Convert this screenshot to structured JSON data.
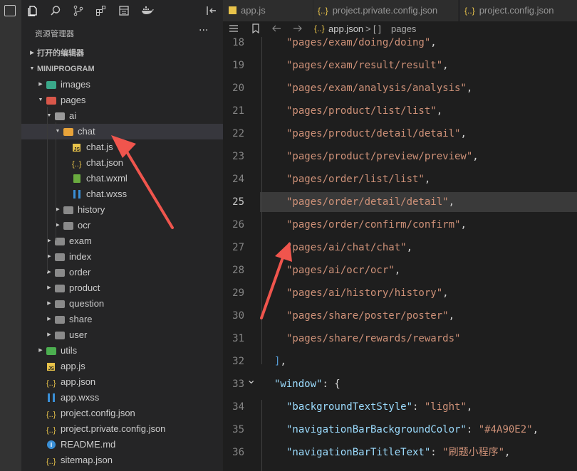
{
  "sidebar": {
    "title": "资源管理器",
    "more": "···",
    "tree": [
      {
        "label": "打开的编辑器",
        "kind": "section",
        "depth": 0,
        "chev": "right"
      },
      {
        "label": "MINIPROGRAM",
        "kind": "section",
        "depth": 0,
        "chev": "down"
      },
      {
        "label": "images",
        "kind": "folder-images",
        "depth": 1,
        "chev": "right"
      },
      {
        "label": "pages",
        "kind": "folder-pages",
        "depth": 1,
        "chev": "down"
      },
      {
        "label": "ai",
        "kind": "folder-open",
        "depth": 2,
        "chev": "down"
      },
      {
        "label": "chat",
        "kind": "folder-chat",
        "depth": 3,
        "chev": "down",
        "selected": true
      },
      {
        "label": "chat.js",
        "kind": "js",
        "depth": 4
      },
      {
        "label": "chat.json",
        "kind": "json",
        "depth": 4
      },
      {
        "label": "chat.wxml",
        "kind": "wxml",
        "depth": 4
      },
      {
        "label": "chat.wxss",
        "kind": "wxss",
        "depth": 4
      },
      {
        "label": "history",
        "kind": "folder",
        "depth": 3,
        "chev": "right"
      },
      {
        "label": "ocr",
        "kind": "folder",
        "depth": 3,
        "chev": "right"
      },
      {
        "label": "exam",
        "kind": "folder",
        "depth": 2,
        "chev": "right"
      },
      {
        "label": "index",
        "kind": "folder",
        "depth": 2,
        "chev": "right"
      },
      {
        "label": "order",
        "kind": "folder",
        "depth": 2,
        "chev": "right"
      },
      {
        "label": "product",
        "kind": "folder",
        "depth": 2,
        "chev": "right"
      },
      {
        "label": "question",
        "kind": "folder",
        "depth": 2,
        "chev": "right"
      },
      {
        "label": "share",
        "kind": "folder",
        "depth": 2,
        "chev": "right"
      },
      {
        "label": "user",
        "kind": "folder",
        "depth": 2,
        "chev": "right"
      },
      {
        "label": "utils",
        "kind": "folder-utils",
        "depth": 1,
        "chev": "right"
      },
      {
        "label": "app.js",
        "kind": "js",
        "depth": 1
      },
      {
        "label": "app.json",
        "kind": "json",
        "depth": 1
      },
      {
        "label": "app.wxss",
        "kind": "wxss",
        "depth": 1
      },
      {
        "label": "project.config.json",
        "kind": "json",
        "depth": 1
      },
      {
        "label": "project.private.config.json",
        "kind": "json",
        "depth": 1
      },
      {
        "label": "README.md",
        "kind": "info",
        "depth": 1
      },
      {
        "label": "sitemap.json",
        "kind": "json",
        "depth": 1
      }
    ]
  },
  "tabs": [
    {
      "label": "app.js",
      "icon": "JS"
    },
    {
      "label": "project.private.config.json",
      "icon": "{..}"
    },
    {
      "label": "project.config.json",
      "icon": "{..}"
    }
  ],
  "breadcrumb": {
    "icon": "{..}",
    "file": "app.json",
    "sep": ">",
    "node_icon": "[ ]",
    "node": "pages"
  },
  "editor": {
    "current_line": 25,
    "lines": [
      {
        "n": 18,
        "indent": 1,
        "str": "\"pages/exam/doing/doing\"",
        "tail": ","
      },
      {
        "n": 19,
        "indent": 1,
        "str": "\"pages/exam/result/result\"",
        "tail": ","
      },
      {
        "n": 20,
        "indent": 1,
        "str": "\"pages/exam/analysis/analysis\"",
        "tail": ","
      },
      {
        "n": 21,
        "indent": 1,
        "str": "\"pages/product/list/list\"",
        "tail": ","
      },
      {
        "n": 22,
        "indent": 1,
        "str": "\"pages/product/detail/detail\"",
        "tail": ","
      },
      {
        "n": 23,
        "indent": 1,
        "str": "\"pages/product/preview/preview\"",
        "tail": ","
      },
      {
        "n": 24,
        "indent": 1,
        "str": "\"pages/order/list/list\"",
        "tail": ","
      },
      {
        "n": 25,
        "indent": 1,
        "str": "\"pages/order/detail/detail\"",
        "tail": ","
      },
      {
        "n": 26,
        "indent": 1,
        "str": "\"pages/order/confirm/confirm\"",
        "tail": ","
      },
      {
        "n": 27,
        "indent": 1,
        "str": "\"pages/ai/chat/chat\"",
        "tail": ","
      },
      {
        "n": 28,
        "indent": 1,
        "str": "\"pages/ai/ocr/ocr\"",
        "tail": ","
      },
      {
        "n": 29,
        "indent": 1,
        "str": "\"pages/ai/history/history\"",
        "tail": ","
      },
      {
        "n": 30,
        "indent": 1,
        "str": "\"pages/share/poster/poster\"",
        "tail": ","
      },
      {
        "n": 31,
        "indent": 1,
        "str": "\"pages/share/rewards/rewards\"",
        "tail": ""
      },
      {
        "n": 32,
        "indent": 0,
        "bracket": "]",
        "tail": ","
      },
      {
        "n": 33,
        "indent": 0,
        "key": "\"window\"",
        "colon": ": ",
        "brace": "{",
        "fold": true
      },
      {
        "n": 34,
        "indent": 1,
        "key": "\"backgroundTextStyle\"",
        "colon": ": ",
        "str": "\"light\"",
        "tail": ","
      },
      {
        "n": 35,
        "indent": 1,
        "key": "\"navigationBarBackgroundColor\"",
        "colon": ": ",
        "str": "\"#4A90E2\"",
        "tail": ","
      },
      {
        "n": 36,
        "indent": 1,
        "key": "\"navigationBarTitleText\"",
        "colon": ": ",
        "str": "\"刷题小程序\"",
        "tail": ","
      }
    ]
  },
  "colors": {
    "arrow": "#f0554d",
    "string": "#ce9178",
    "key": "#9cdcfe"
  }
}
